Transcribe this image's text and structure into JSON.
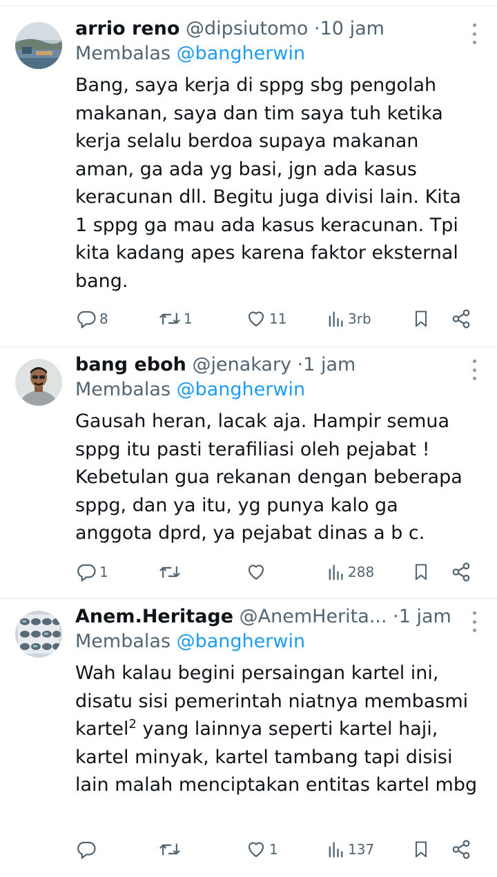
{
  "replies": [
    {
      "name": "arrio reno",
      "handle": "@dipsiutomo",
      "time": "10 jam",
      "reply_prefix": "Membalas",
      "reply_to": "@bangherwin",
      "text": "Bang, saya kerja di sppg sbg pengolah makanan, saya dan tim saya tuh ketika kerja selalu berdoa supaya makanan aman, ga ada yg basi, jgn ada kasus keracunan dll. Begitu juga divisi lain. Kita 1 sppg ga mau ada kasus keracunan. Tpi kita kadang apes karena faktor eksternal bang.",
      "stats": {
        "replies": "8",
        "retweets": "1",
        "likes": "11",
        "views": "3rb"
      }
    },
    {
      "name": "bang eboh",
      "handle": "@jenakary",
      "time": "1 jam",
      "reply_prefix": "Membalas",
      "reply_to": "@bangherwin",
      "text": "Gausah heran, lacak aja. Hampir semua sppg itu pasti terafiliasi oleh pejabat ! Kebetulan gua rekanan dengan beberapa sppg, dan ya itu, yg punya kalo ga anggota dprd, ya pejabat dinas a b c.",
      "stats": {
        "replies": "1",
        "retweets": "",
        "likes": "",
        "views": "288"
      }
    },
    {
      "name": "Anem.Heritage",
      "handle": "@AnemHerita...",
      "time": "1 jam",
      "reply_prefix": "Membalas",
      "reply_to": "@bangherwin",
      "text_a": "Wah kalau begini persaingan kartel ini, disatu sisi pemerintah niatnya membasmi kartel",
      "text_sup": "2",
      "text_b": " yang lainnya seperti kartel haji, kartel minyak, kartel tambang tapi disisi lain malah menciptakan entitas kartel mbg",
      "stats": {
        "replies": "",
        "retweets": "",
        "likes": "1",
        "views": "137"
      }
    }
  ],
  "icons": {
    "reply": "reply-icon",
    "retweet": "retweet-icon",
    "like": "heart-icon",
    "views": "views-icon",
    "bookmark": "bookmark-icon",
    "share": "share-icon",
    "more": "more-icon"
  },
  "colors": {
    "text": "#0f1419",
    "secondary": "#536471",
    "mention": "#1d9bf0",
    "divider": "#e6e9eb"
  }
}
